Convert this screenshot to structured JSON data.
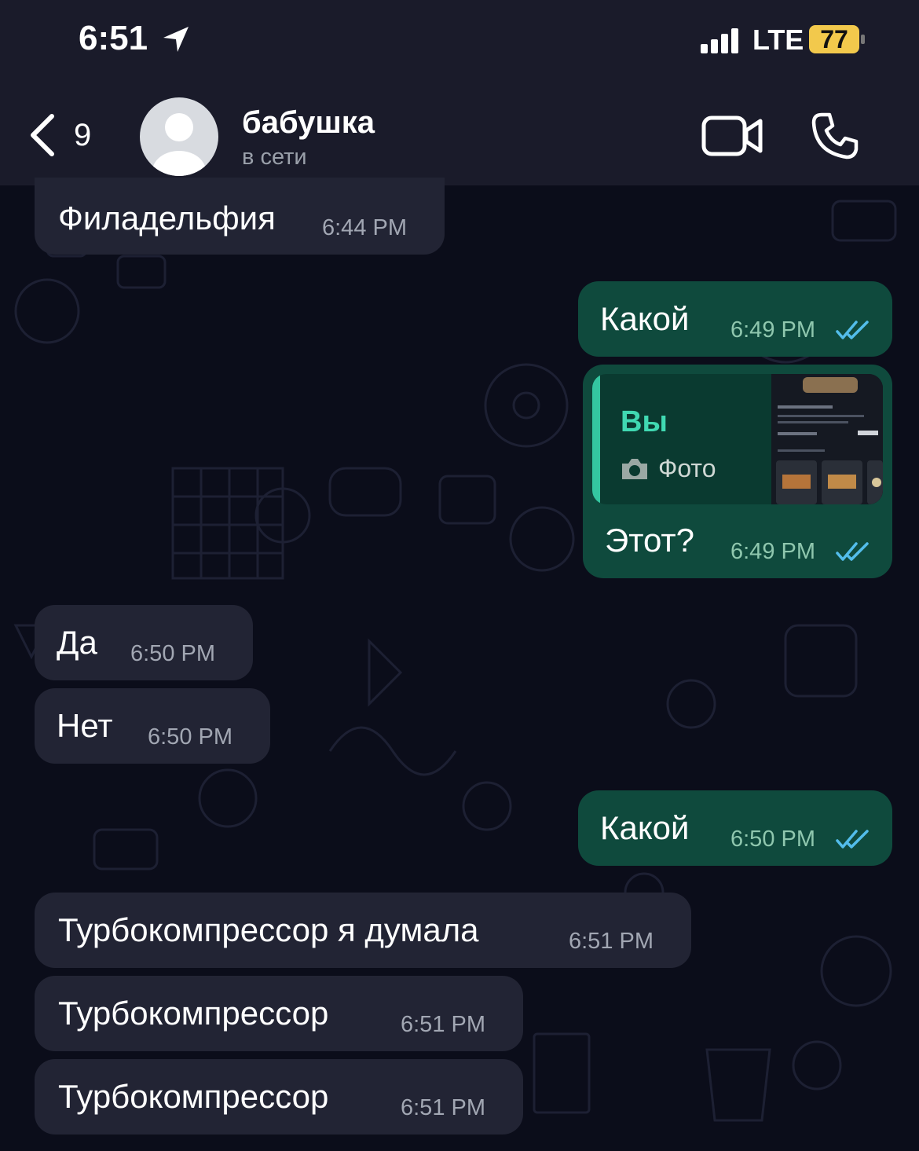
{
  "status_bar": {
    "time": "6:51",
    "network": "LTE",
    "battery": "77"
  },
  "header": {
    "back_count": "9",
    "contact_name": "бабушка",
    "contact_status": "в сети"
  },
  "quoted_reply": {
    "author": "Вы",
    "type_label": "Фото"
  },
  "messages": [
    {
      "direction": "in",
      "text": "Филадельфия",
      "time": "6:44 PM"
    },
    {
      "direction": "out",
      "text": "Какой",
      "time": "6:49 PM",
      "read": true
    },
    {
      "direction": "out",
      "text": "Этот?",
      "time": "6:49 PM",
      "read": true,
      "reply_to": "quoted_reply"
    },
    {
      "direction": "in",
      "text": "Да",
      "time": "6:50 PM"
    },
    {
      "direction": "in",
      "text": "Нет",
      "time": "6:50 PM"
    },
    {
      "direction": "out",
      "text": "Какой",
      "time": "6:50 PM",
      "read": true
    },
    {
      "direction": "in",
      "text": "Турбокомпрессор я думала",
      "time": "6:51 PM"
    },
    {
      "direction": "in",
      "text": "Турбокомпрессор",
      "time": "6:51 PM"
    },
    {
      "direction": "in",
      "text": "Турбокомпрессор",
      "time": "6:51 PM"
    }
  ],
  "colors": {
    "incoming_bubble": "#222434",
    "outgoing_bubble": "#0f4a3d",
    "read_ticks": "#53bdeb",
    "background": "#0b0d1a"
  }
}
